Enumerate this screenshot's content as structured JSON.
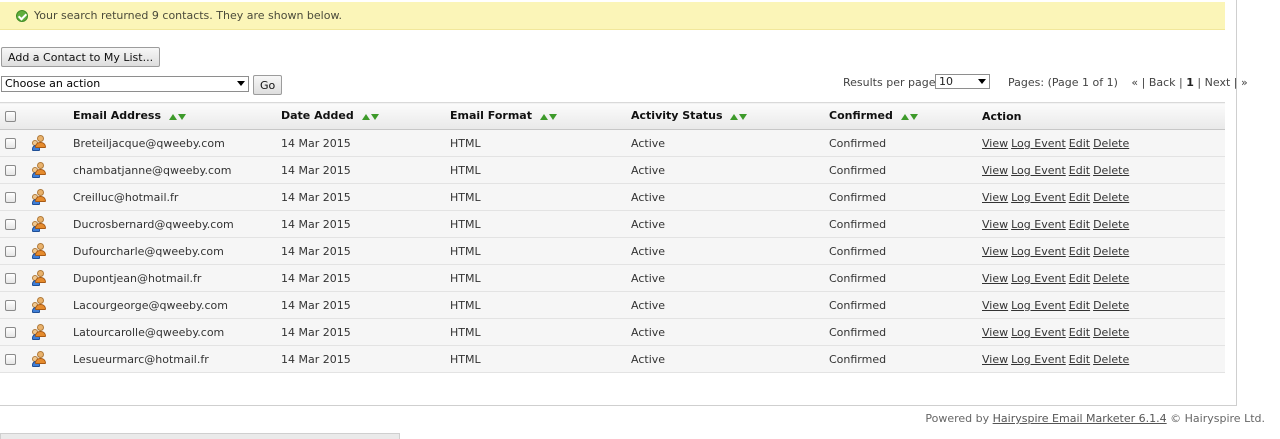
{
  "notice": {
    "text": "Your search returned 9 contacts. They are shown below."
  },
  "toolbar": {
    "add_label": "Add a Contact to My List...",
    "action_placeholder": "Choose an action",
    "go_label": "Go"
  },
  "paging": {
    "rpp_label": "Results per page:",
    "rpp_value": "10",
    "pages_label": "Pages: (Page 1 of 1)",
    "first": "«",
    "back": "Back",
    "current": "1",
    "next": "Next",
    "last": "»"
  },
  "table": {
    "headers": [
      "Email Address",
      "Date Added",
      "Email Format",
      "Activity Status",
      "Confirmed",
      "Action"
    ],
    "action_links": [
      "View",
      "Log Event",
      "Edit",
      "Delete"
    ],
    "rows": [
      {
        "email": "Breteiljacque@qweeby.com",
        "date": "14 Mar 2015",
        "format": "HTML",
        "status": "Active",
        "confirmed": "Confirmed"
      },
      {
        "email": "chambatjanne@qweeby.com",
        "date": "14 Mar 2015",
        "format": "HTML",
        "status": "Active",
        "confirmed": "Confirmed"
      },
      {
        "email": "Creilluc@hotmail.fr",
        "date": "14 Mar 2015",
        "format": "HTML",
        "status": "Active",
        "confirmed": "Confirmed"
      },
      {
        "email": "Ducrosbernard@qweeby.com",
        "date": "14 Mar 2015",
        "format": "HTML",
        "status": "Active",
        "confirmed": "Confirmed"
      },
      {
        "email": "Dufourcharle@qweeby.com",
        "date": "14 Mar 2015",
        "format": "HTML",
        "status": "Active",
        "confirmed": "Confirmed"
      },
      {
        "email": "Dupontjean@hotmail.fr",
        "date": "14 Mar 2015",
        "format": "HTML",
        "status": "Active",
        "confirmed": "Confirmed"
      },
      {
        "email": "Lacourgeorge@qweeby.com",
        "date": "14 Mar 2015",
        "format": "HTML",
        "status": "Active",
        "confirmed": "Confirmed"
      },
      {
        "email": "Latourcarolle@qweeby.com",
        "date": "14 Mar 2015",
        "format": "HTML",
        "status": "Active",
        "confirmed": "Confirmed"
      },
      {
        "email": "Lesueurmarc@hotmail.fr",
        "date": "14 Mar 2015",
        "format": "HTML",
        "status": "Active",
        "confirmed": "Confirmed"
      }
    ]
  },
  "footer": {
    "prefix": "Powered by",
    "link": "Hairyspire Email Marketer 6.1.4",
    "suffix": "© Hairyspire Ltd."
  },
  "colors": {
    "notice_bg": "#fbf5b8",
    "sort_arrow": "#3d9a2a"
  }
}
